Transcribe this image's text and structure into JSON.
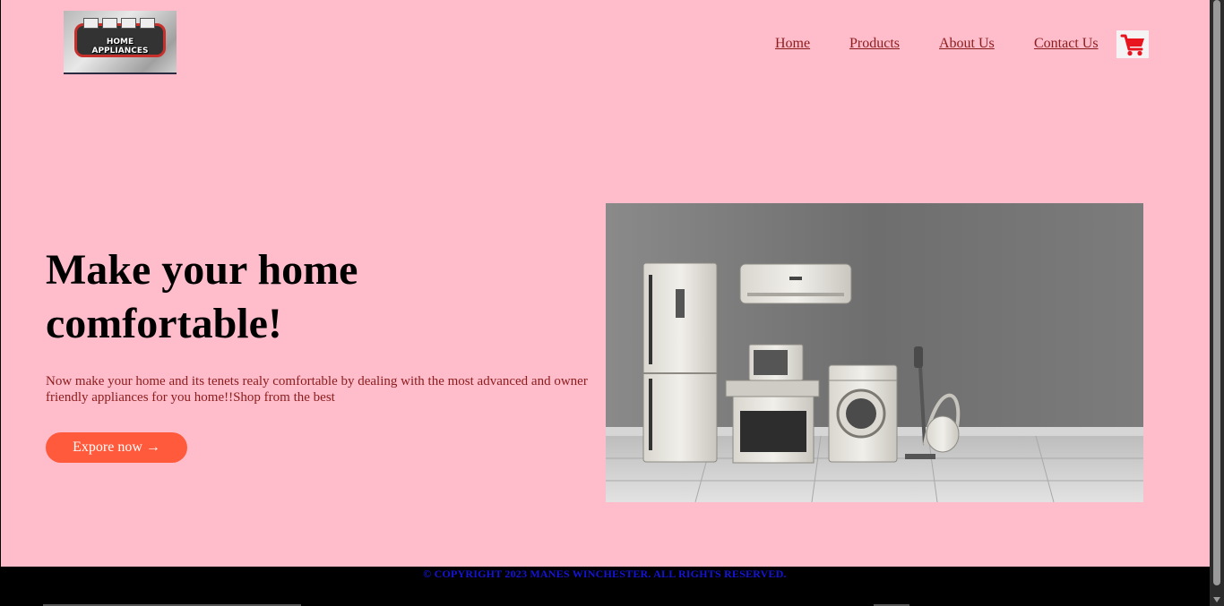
{
  "logo": {
    "line1": "HOME",
    "line2": "APPLIANCES"
  },
  "nav": {
    "items": [
      {
        "label": "Home"
      },
      {
        "label": "Products"
      },
      {
        "label": "About Us"
      },
      {
        "label": "Contact Us"
      }
    ],
    "cart_icon": "shopping-cart-icon",
    "cart_color": "#e8141e"
  },
  "hero": {
    "title": "Make your home comfortable!",
    "description": "Now make your home and its tenets realy comfortable by dealing with the most advanced and owner friendly appliances for you home!!Shop from the best",
    "cta_label": "Expore now →"
  },
  "footer": {
    "copyright": "© COPYRIGHT 2023 MANES WINCHESTER. ALL RIGHTS RESERVED."
  },
  "colors": {
    "page_background": "#ffbccb",
    "link": "#8b1c1c",
    "cta_background": "#ff5a3c",
    "footer_text": "#1414d8",
    "footer_background": "#000000"
  }
}
